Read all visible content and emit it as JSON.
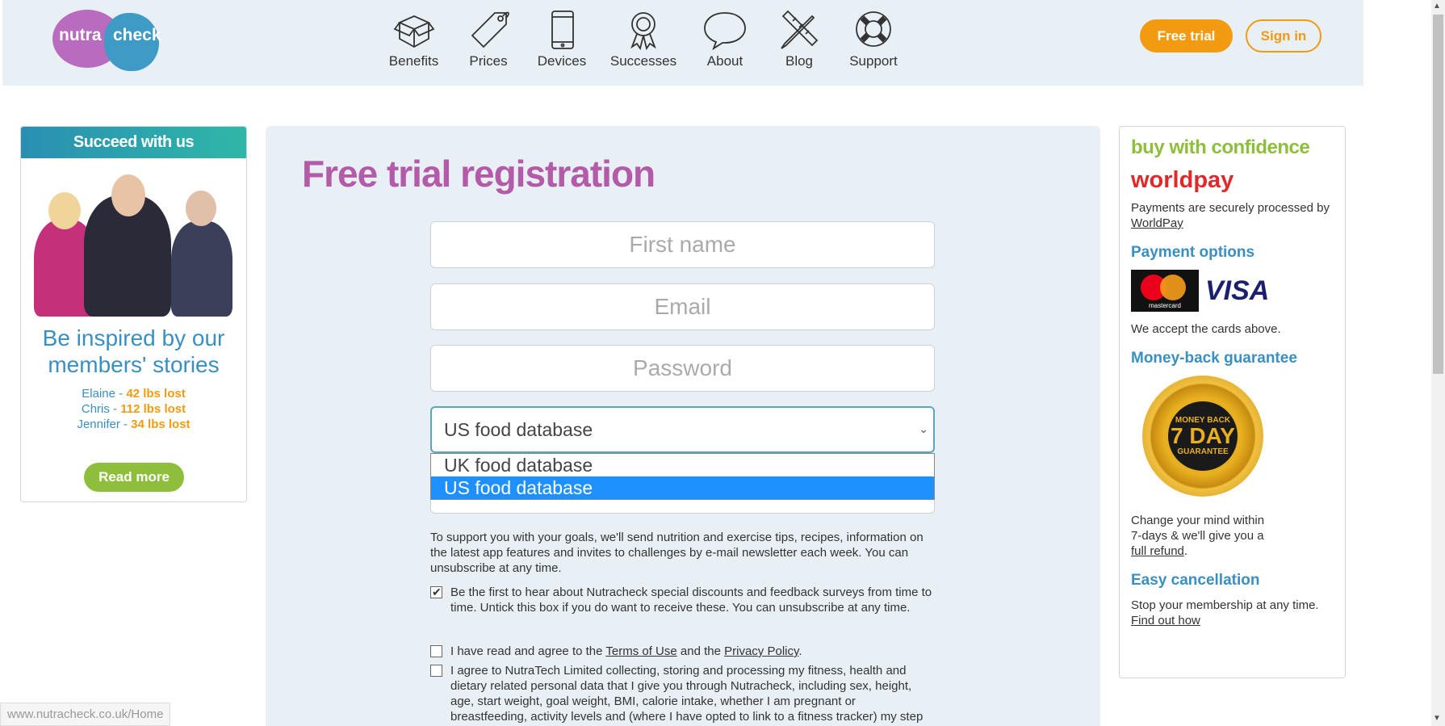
{
  "header": {
    "logo": {
      "part1": "nutra",
      "part2": "check"
    },
    "nav": [
      {
        "label": "Benefits",
        "icon": "box-icon"
      },
      {
        "label": "Prices",
        "icon": "price-tag-icon"
      },
      {
        "label": "Devices",
        "icon": "phone-icon"
      },
      {
        "label": "Successes",
        "icon": "award-ribbon-icon"
      },
      {
        "label": "About",
        "icon": "speech-bubble-icon"
      },
      {
        "label": "Blog",
        "icon": "pencil-ruler-icon"
      },
      {
        "label": "Support",
        "icon": "lifebuoy-icon"
      }
    ],
    "free_trial": "Free trial",
    "sign_in": "Sign in"
  },
  "left": {
    "banner": "Succeed with us",
    "headline": "Be inspired by our members' stories",
    "stats": [
      {
        "name": "Elaine",
        "lost": "42 lbs lost"
      },
      {
        "name": "Chris",
        "lost": "112 lbs lost"
      },
      {
        "name": "Jennifer",
        "lost": "34 lbs lost"
      }
    ],
    "read_more": "Read more"
  },
  "form": {
    "title": "Free trial registration",
    "first_name_placeholder": "First name",
    "email_placeholder": "Email",
    "password_placeholder": "Password",
    "database_selected": "US food database",
    "database_options": [
      "UK food database",
      "US food database"
    ],
    "info": "To support you with your goals, we'll send nutrition and exercise tips, recipes, information on the latest app features and invites to challenges by e-mail newsletter each week. You can unsubscribe at any time.",
    "offers_checked": true,
    "offers_text": "Be the first to hear about Nutracheck special discounts and feedback surveys from time to time. Untick this box if you do want to receive these. You can unsubscribe at any time.",
    "terms_checked": false,
    "terms_prefix": "I have read and agree to the ",
    "terms_link": "Terms of Use",
    "terms_mid": " and the ",
    "privacy_link": "Privacy Policy",
    "terms_suffix": ".",
    "data_checked": false,
    "data_text": "I agree to NutraTech Limited collecting, storing and processing my fitness, health and dietary related personal data that I give you through Nutracheck, including sex, height, age, start weight, goal weight, BMI, calorie intake, whether I am pregnant or breastfeeding, activity levels and (where I have opted to link to a fitness tracker) my step"
  },
  "right": {
    "buy_confidence": "buy with confidence",
    "worldpay": "worldpay",
    "processed_text": "Payments are securely processed by",
    "worldpay_link": "WorldPay",
    "payment_options": "Payment options",
    "mastercard": "mastercard",
    "visa": "VISA",
    "accept_text": "We accept the cards above.",
    "money_back": "Money-back guarantee",
    "badge_top": "MONEY BACK",
    "badge_mid": "7 DAY",
    "badge_bottom": "GUARANTEE",
    "change_mind": "Change your mind within 7-days & we'll give you a",
    "full_refund": "full refund",
    "easy_cancel": "Easy cancellation",
    "stop_text": "Stop your membership at any time.",
    "find_out": "Find out how"
  },
  "status_url": "www.nutracheck.co.uk/Home",
  "colors": {
    "brand_purple": "#b35aa8",
    "brand_blue": "#3a8fc2",
    "orange": "#f29a10",
    "green": "#8dbf3c",
    "header_bg": "#e8f0f6",
    "select_highlight": "#1e90ff"
  }
}
